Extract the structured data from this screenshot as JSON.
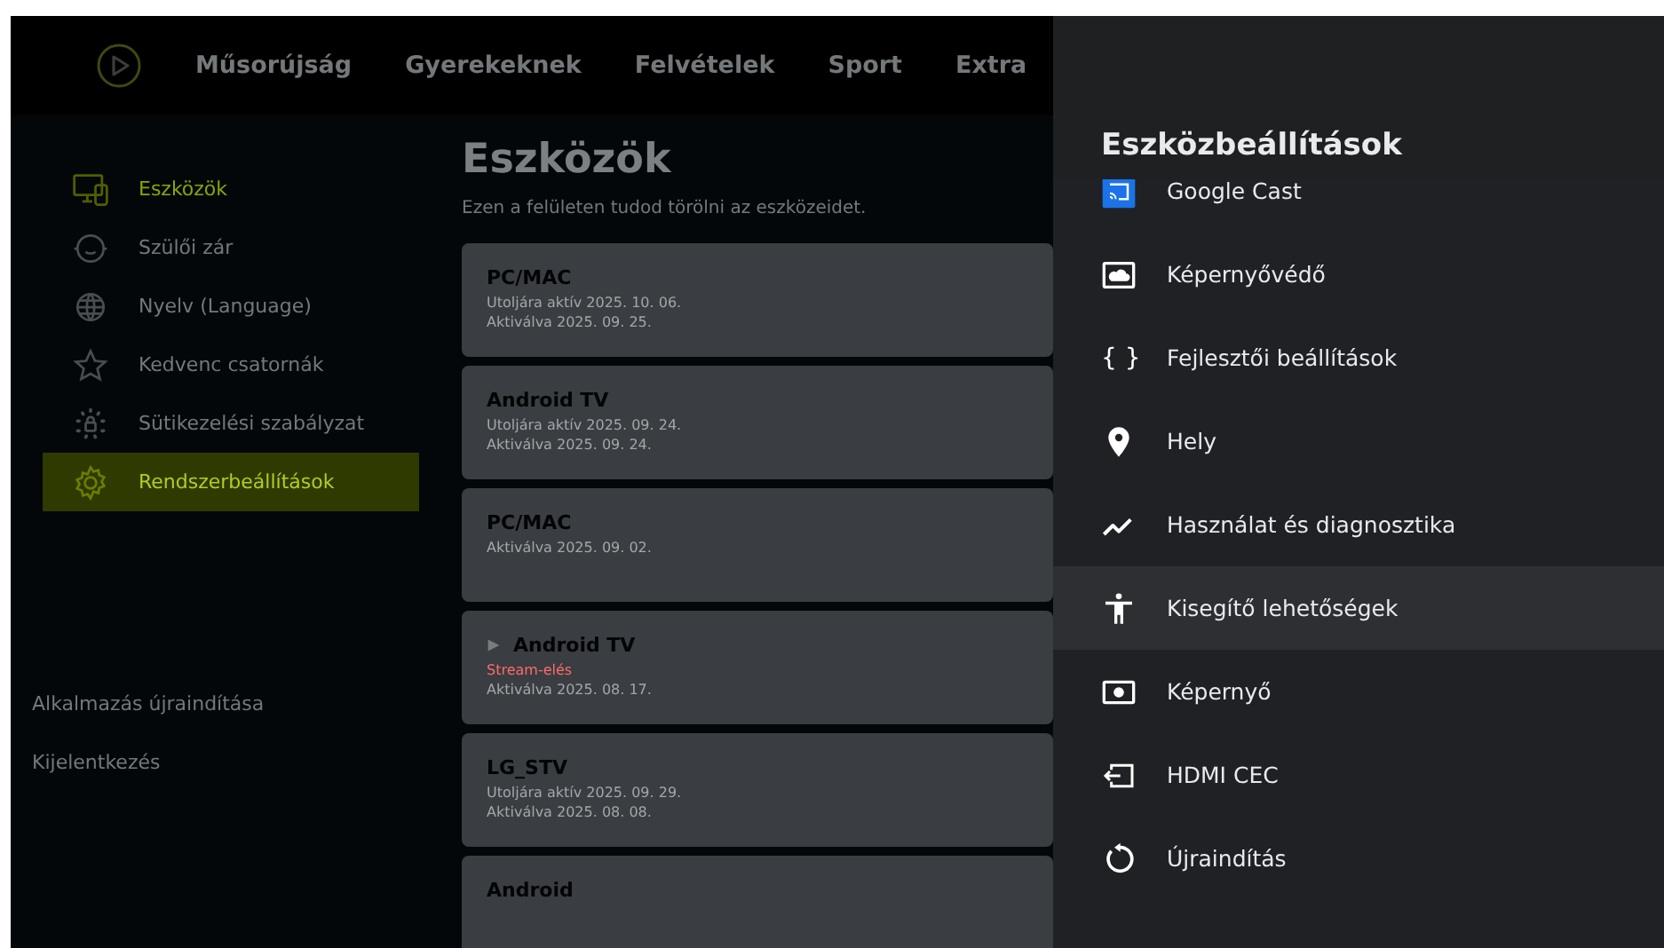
{
  "nav": {
    "items": [
      {
        "label": "Műsorújság"
      },
      {
        "label": "Gyerekeknek"
      },
      {
        "label": "Felvételek"
      },
      {
        "label": "Sport"
      },
      {
        "label": "Extra"
      }
    ]
  },
  "sidebar": {
    "items": [
      {
        "kind": "devices",
        "label": "Eszközök",
        "selected": false,
        "current": true
      },
      {
        "kind": "face",
        "label": "Szülői zár",
        "selected": false,
        "current": false
      },
      {
        "kind": "globe",
        "label": "Nyelv (Language)",
        "selected": false,
        "current": false
      },
      {
        "kind": "star",
        "label": "Kedvenc csatornák",
        "selected": false,
        "current": false
      },
      {
        "kind": "cookie",
        "label": "Sütikezelési szabályzat",
        "selected": false,
        "current": false
      },
      {
        "kind": "gear",
        "label": "Rendszerbeállítások",
        "selected": true,
        "current": false
      }
    ],
    "bottom_links": [
      "Alkalmazás újraindítása",
      "Kijelentkezés"
    ]
  },
  "main": {
    "title": "Eszközök",
    "subtitle": "Ezen a felületen tudod törölni az eszközeidet.",
    "devices": [
      {
        "name": "PC/MAC",
        "playing": false,
        "lines": [
          {
            "kind": "info",
            "text": "Utoljára aktív 2025. 10. 06."
          },
          {
            "kind": "info",
            "text": "Aktiválva 2025. 09. 25."
          }
        ]
      },
      {
        "name": "Android TV",
        "playing": false,
        "lines": [
          {
            "kind": "info",
            "text": "Utoljára aktív 2025. 09. 24."
          },
          {
            "kind": "info",
            "text": "Aktiválva 2025. 09. 24."
          }
        ]
      },
      {
        "name": "PC/MAC",
        "playing": false,
        "lines": [
          {
            "kind": "info",
            "text": "Aktiválva 2025. 09. 02."
          }
        ]
      },
      {
        "name": "Android TV",
        "playing": true,
        "lines": [
          {
            "kind": "stream",
            "text": "Stream-elés"
          },
          {
            "kind": "info",
            "text": "Aktiválva 2025. 08. 17."
          }
        ]
      },
      {
        "name": "LG_STV",
        "playing": false,
        "lines": [
          {
            "kind": "info",
            "text": "Utoljára aktív 2025. 09. 29."
          },
          {
            "kind": "info",
            "text": "Aktiválva 2025. 08. 08."
          }
        ]
      },
      {
        "name": "Android",
        "playing": false
      }
    ]
  },
  "panel": {
    "title": "Eszközbeállítások",
    "items": [
      {
        "kind": "cast",
        "label": "Google Cast",
        "selected": false
      },
      {
        "kind": "screensaver",
        "label": "Képernyővédő",
        "selected": false
      },
      {
        "kind": "braces",
        "glyph": "{ }",
        "label": "Fejlesztői beállítások",
        "selected": false
      },
      {
        "kind": "location",
        "label": "Hely",
        "selected": false
      },
      {
        "kind": "chart",
        "label": "Használat és diagnosztika",
        "selected": false
      },
      {
        "kind": "accessibility",
        "label": "Kisegítő lehetőségek",
        "selected": true
      },
      {
        "kind": "display",
        "label": "Képernyő",
        "selected": false
      },
      {
        "kind": "input",
        "label": "HDMI CEC",
        "selected": false
      },
      {
        "kind": "restart",
        "label": "Újraindítás",
        "selected": false
      }
    ]
  }
}
